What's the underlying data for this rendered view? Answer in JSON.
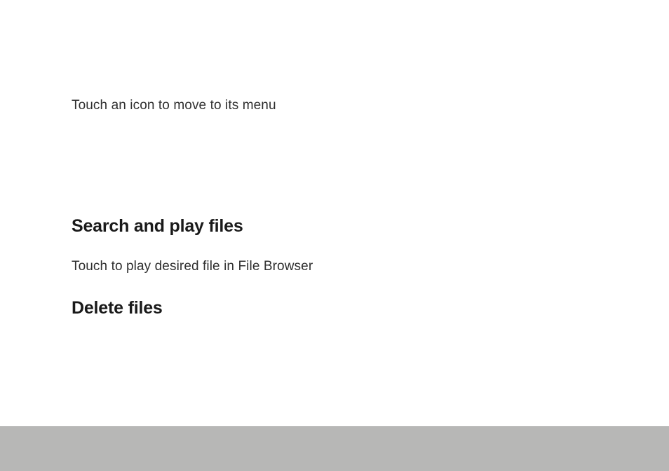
{
  "intro": {
    "instruction": "Touch an icon to move to its menu"
  },
  "sections": {
    "searchAndPlay": {
      "heading": "Search and play files",
      "body": "Touch to play desired file in File Browser"
    },
    "deleteFiles": {
      "heading": "Delete files"
    }
  }
}
